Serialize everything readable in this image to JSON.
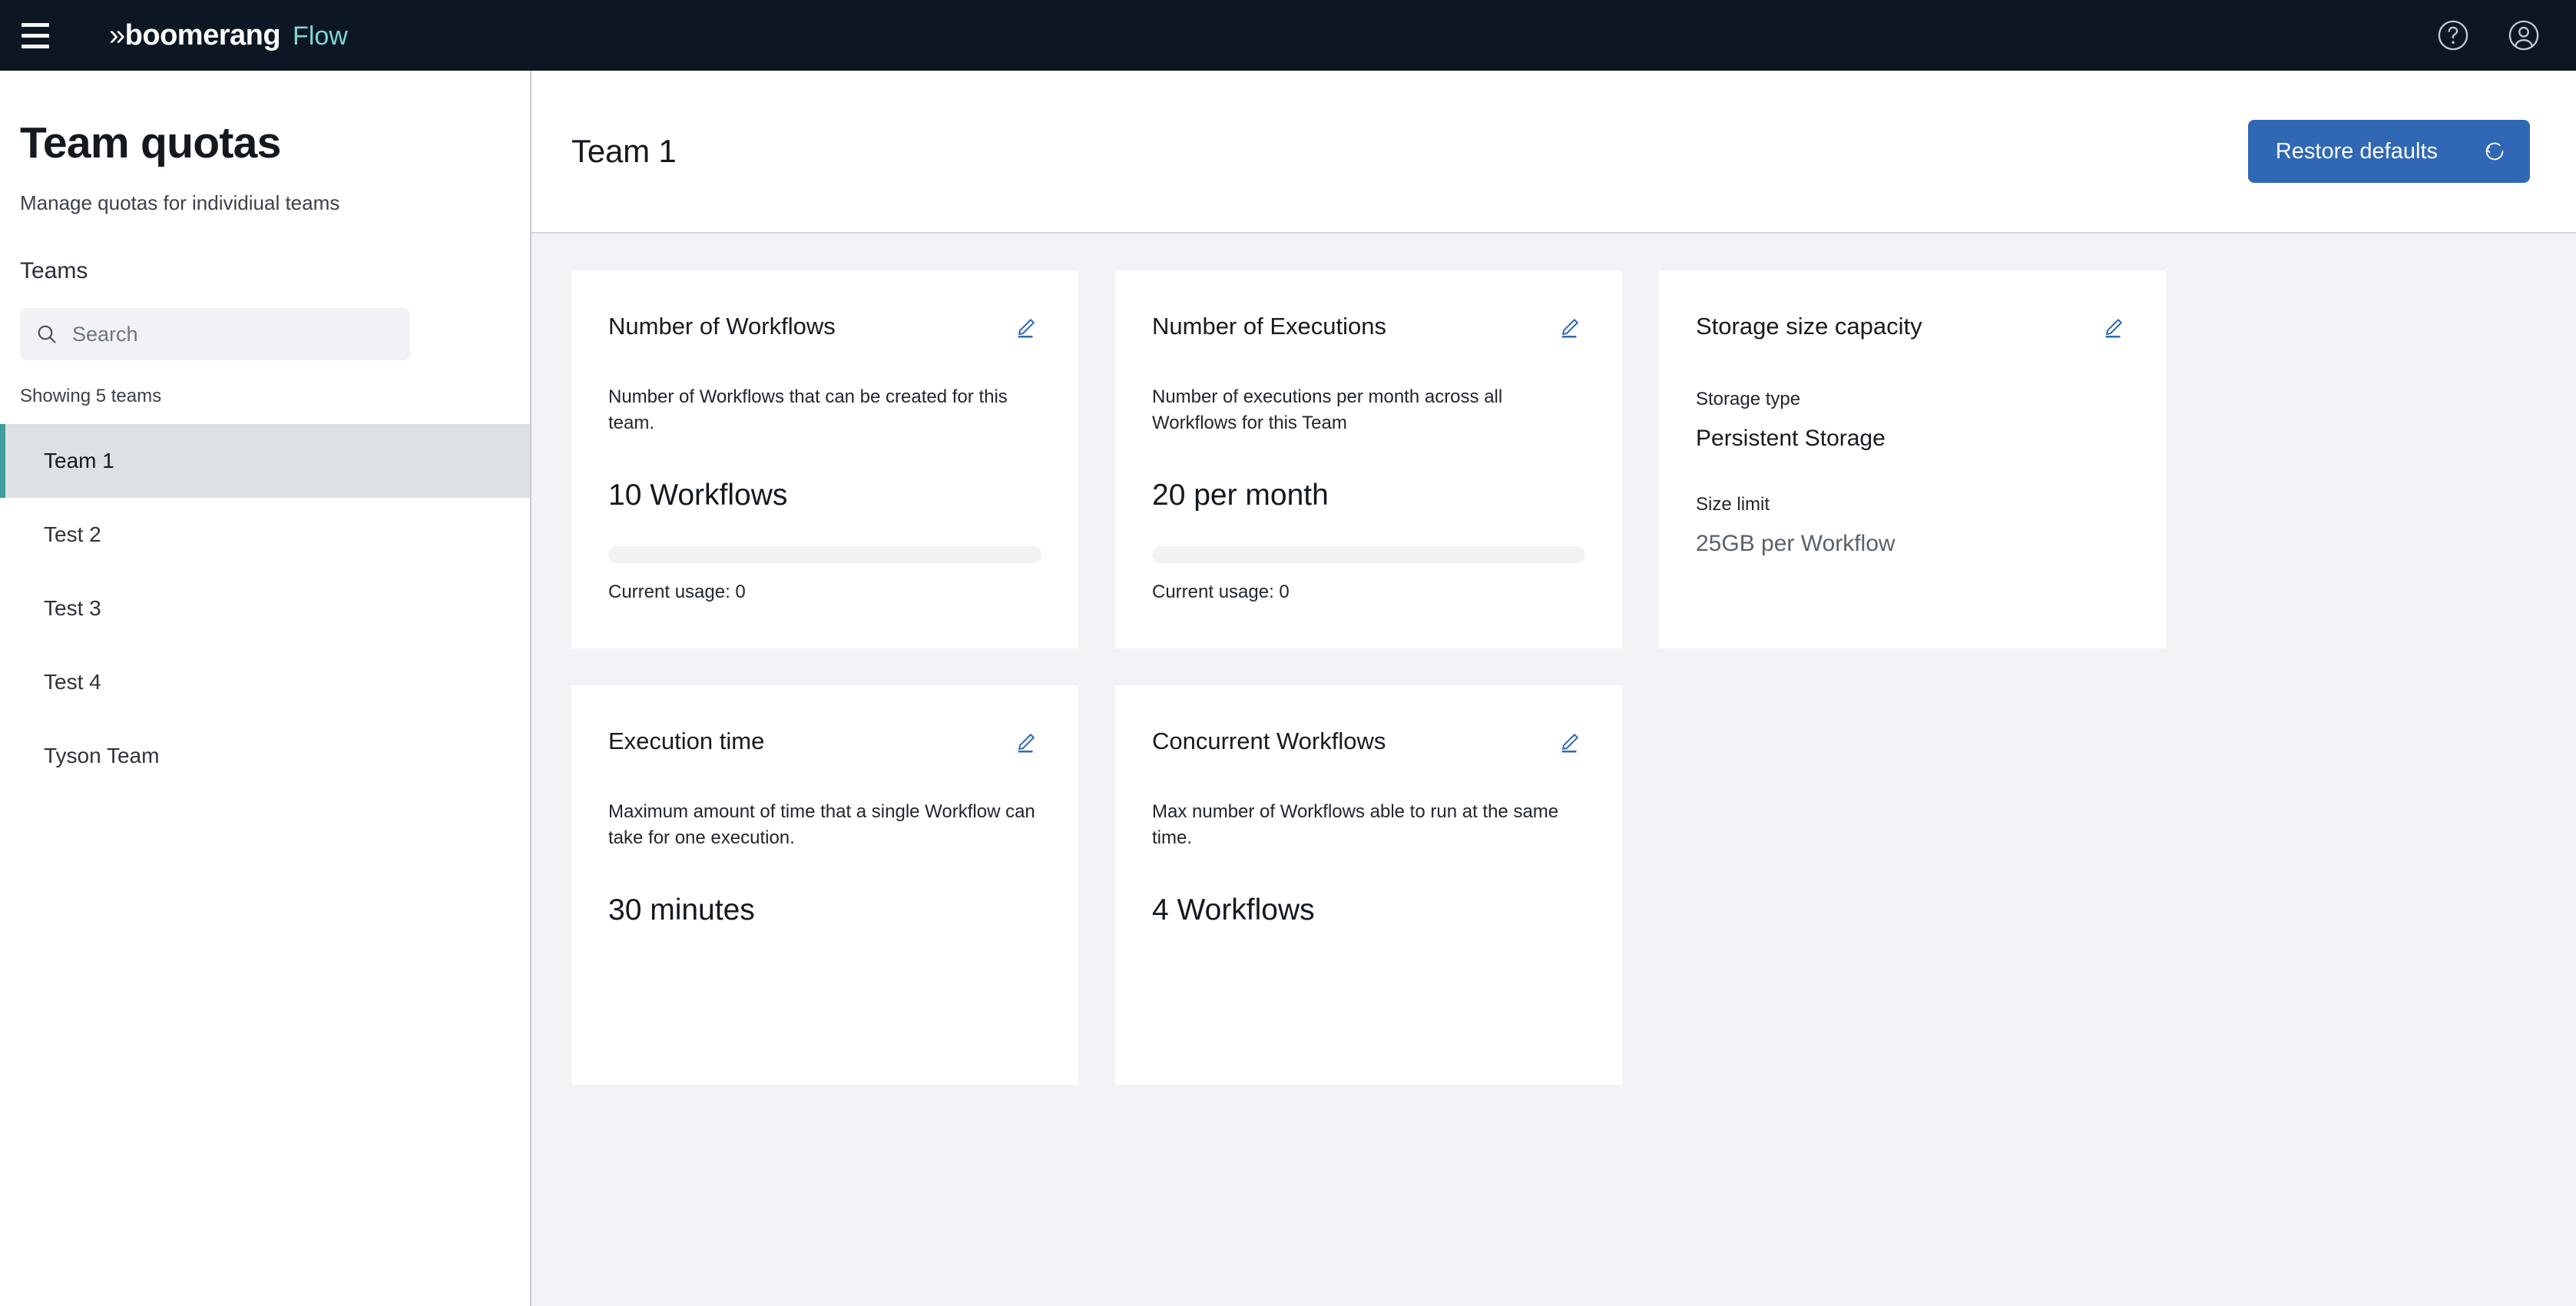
{
  "header": {
    "menu_icon": "hamburger-menu-icon",
    "brand_chevron": "»",
    "brand_name": "boomerang",
    "product_name": "Flow",
    "help_icon": "help-circle-icon",
    "account_icon": "user-avatar-icon",
    "background_color": "#0d1724",
    "product_color": "#7fd4d4"
  },
  "sidebar": {
    "title": "Team quotas",
    "subtitle": "Manage quotas for individiual teams",
    "teams_label": "Teams",
    "search": {
      "icon": "search-icon",
      "placeholder": "Search",
      "value": ""
    },
    "showing_count": "Showing 5 teams",
    "teams": [
      {
        "label": "Team 1",
        "selected": true
      },
      {
        "label": "Test 2",
        "selected": false
      },
      {
        "label": "Test 3",
        "selected": false
      },
      {
        "label": "Test 4",
        "selected": false
      },
      {
        "label": "Tyson Team",
        "selected": false
      }
    ],
    "selected_accent_color": "#3d9e9e",
    "selected_background_color": "#dde1e6"
  },
  "main": {
    "team_heading": "Team 1",
    "restore_button": {
      "label": "Restore defaults",
      "icon": "restore-reset-icon",
      "background_color": "#3068b5"
    },
    "edit_icon": "edit-pencil-icon",
    "edit_icon_color": "#3068b5",
    "cards": [
      {
        "title": "Number of Workflows",
        "description": "Number of Workflows that can be created for this team.",
        "value": "10 Workflows",
        "has_progress": true,
        "progress_percent": 0,
        "usage": "Current usage: 0"
      },
      {
        "title": "Number of Executions",
        "description": "Number of executions per month across all Workflows for this Team",
        "value": "20 per month",
        "has_progress": true,
        "progress_percent": 0,
        "usage": "Current usage: 0"
      },
      {
        "title": "Storage size capacity",
        "storage_type_label": "Storage type",
        "storage_type_value": "Persistent Storage",
        "size_limit_label": "Size limit",
        "size_limit_value": "25GB per Workflow"
      },
      {
        "title": "Execution time",
        "description": "Maximum amount of time that a single Workflow can take for one execution.",
        "value": "30 minutes",
        "has_progress": false
      },
      {
        "title": "Concurrent Workflows",
        "description": "Max number of Workflows able to run at the same time.",
        "value": "4 Workflows",
        "has_progress": false
      }
    ]
  }
}
